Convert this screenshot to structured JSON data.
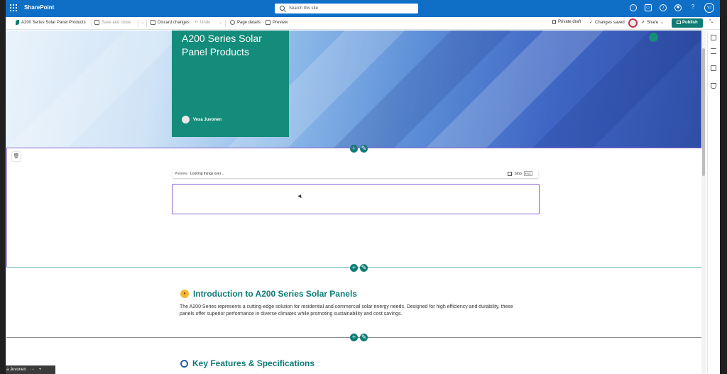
{
  "suite": {
    "brand": "SharePoint",
    "search_placeholder": "Search this site",
    "user_initials": "VJ"
  },
  "command_bar": {
    "page_name": "A200 Series Solar Panel Products",
    "save_close": "Save and close",
    "discard": "Discard changes",
    "undo": "Undo",
    "page_details": "Page details",
    "preview": "Preview",
    "draft_status": "Private draft",
    "saved_status": "Changes saved",
    "share": "Share",
    "publish": "Publish"
  },
  "hero": {
    "title": "A200 Series Solar Panel Products",
    "author": "Vesa Juvonen"
  },
  "copilot": {
    "tag": "Preview",
    "message": "Looking things over...",
    "stop": "Stop",
    "esc": "ESC"
  },
  "content": {
    "intro_heading": "Introduction to A200 Series Solar Panels",
    "intro_text": "The A200 Series represents a cutting-edge solution for residential and commercial solar energy needs. Designed for high efficiency and durability, these panels offer superior performance in diverse climates while promoting sustainability and cost savings.",
    "features_heading": "Key Features & Specifications"
  },
  "taskbar": {
    "label": "a Juvonen"
  },
  "colors": {
    "suitebar": "#0f6fc6",
    "accent": "#0e7c74",
    "selection": "#8a63d2"
  }
}
